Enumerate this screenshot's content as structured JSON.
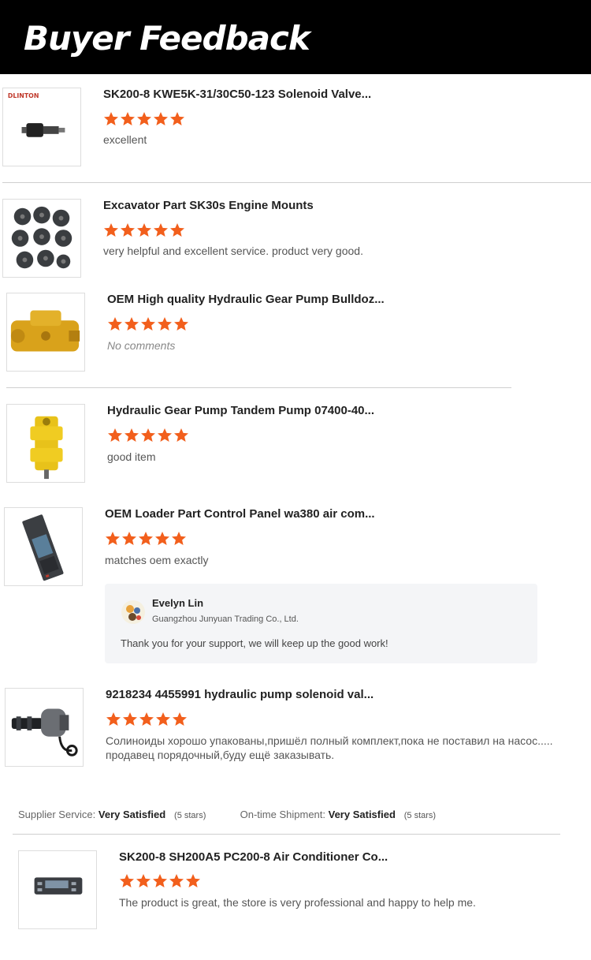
{
  "banner": {
    "title": "Buyer Feedback"
  },
  "colors": {
    "star": "#f25f1c",
    "banner_bg": "#000000"
  },
  "reviews": [
    {
      "title": "SK200-8 KWE5K-31/30C50-123 Solenoid Valve...",
      "rating": 5,
      "comment": "excellent",
      "image": "solenoid-valve-image",
      "logo": "DLINTON"
    },
    {
      "title": "Excavator Part SK30s Engine Mounts",
      "rating": 5,
      "comment": "very helpful and excellent service. product very good.",
      "image": "engine-mounts-image"
    },
    {
      "title": "OEM High quality Hydraulic Gear Pump Bulldoz...",
      "rating": 5,
      "comment": "No comments",
      "image": "gear-pump-image"
    },
    {
      "title": "Hydraulic Gear Pump Tandem Pump 07400-40...",
      "rating": 5,
      "comment": "good item",
      "image": "tandem-pump-image"
    },
    {
      "title": "OEM Loader Part Control Panel wa380 air com...",
      "rating": 5,
      "comment": "matches oem exactly",
      "image": "control-panel-image"
    },
    {
      "title": "9218234 4455991 hydraulic pump solenoid val...",
      "rating": 5,
      "comment": "Солиноиды хорошо упакованы,пришёл полный комплект,пока не поставил на насос..... продавец порядочный,буду ещё  заказывать.",
      "image": "pump-solenoid-image"
    },
    {
      "title": "SK200-8 SH200A5 PC200-8 Air Conditioner Co...",
      "rating": 5,
      "comment": "The product is great, the store is very professional and happy to help me.",
      "image": "ac-controller-image"
    }
  ],
  "reply": {
    "name": "Evelyn Lin",
    "company": "Guangzhou Junyuan Trading Co., Ltd.",
    "text": "Thank you for your support, we will keep up the good work!"
  },
  "ratings": {
    "supplier_label": "Supplier Service:",
    "supplier_value": "Very Satisfied",
    "supplier_sub": "(5 stars)",
    "shipment_label": "On-time Shipment:",
    "shipment_value": "Very Satisfied",
    "shipment_sub": "(5 stars)"
  }
}
